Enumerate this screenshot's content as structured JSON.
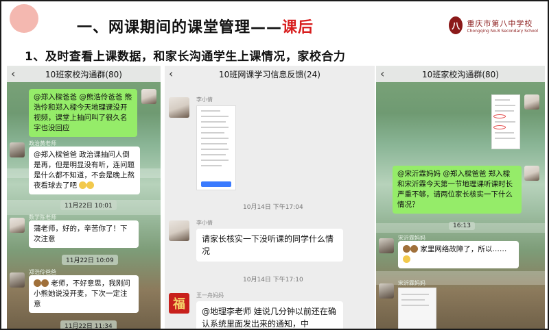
{
  "slide": {
    "title_main": "一、网课期间的课堂管理——",
    "title_highlight": "课后",
    "subtitle": "1、及时查看上课数据，和家长沟通学生上课情况，家校合力",
    "logo_cn": "重庆市第八中学校",
    "logo_en": "Chongqing No.8 Secondary School",
    "logo_seal": "八"
  },
  "phone1": {
    "nav_title": "10班家校沟通群(80)",
    "back_icon": "‹",
    "msg1": "@郑入樑爸爸 @熊浩伶爸爸 熊浩伶和郑入樑今天地理课没开视频，课堂上抽问叫了很久名字也没回应",
    "sender2": "政治黄老师",
    "msg2": "@郑入樑爸爸 政治课抽问人倒是再，但是明显没有听，连问题是什么都不知道，不会是晚上熬夜看球去了吧",
    "time1": "11月22日 10:01",
    "sender3": "数学陈老师",
    "msg3": "蒲老师，好的，辛苦你了！下次注意",
    "time2": "11月22日 10:09",
    "sender4": "郑浩伶爸爸",
    "msg4": "老师，不好意思，我刚问小熊她说没开麦，下次一定注意",
    "time3": "11月22日 11:34"
  },
  "phone2": {
    "nav_title": "10班网课学习信息反馈(24)",
    "back_icon": "‹",
    "sender1": "李小倩",
    "time1": "10月14日 下午17:04",
    "sender2": "李小倩",
    "msg2": "请家长核实一下没听课的同学什么情况",
    "time2": "10月14日 下午17:10",
    "sender3": "王一舟妈妈",
    "avatar3": "福",
    "msg3": "@地理李老师  娃说几分钟以前还在确认系统里面发出来的通知，中"
  },
  "phone3": {
    "nav_title": "10班家校沟通群(80)",
    "back_icon": "‹",
    "msg1": "@宋沂霖妈妈 @郑入樑爸爸 郑入樑和宋沂霖今天第一节地理课听课时长严重不够，请两位家长核实一下什么情况？",
    "time1": "16:13",
    "sender2": "宋沂霖妈妈",
    "msg2": "家里网络故障了，所以……",
    "sender3": "宋沂霖妈妈"
  }
}
